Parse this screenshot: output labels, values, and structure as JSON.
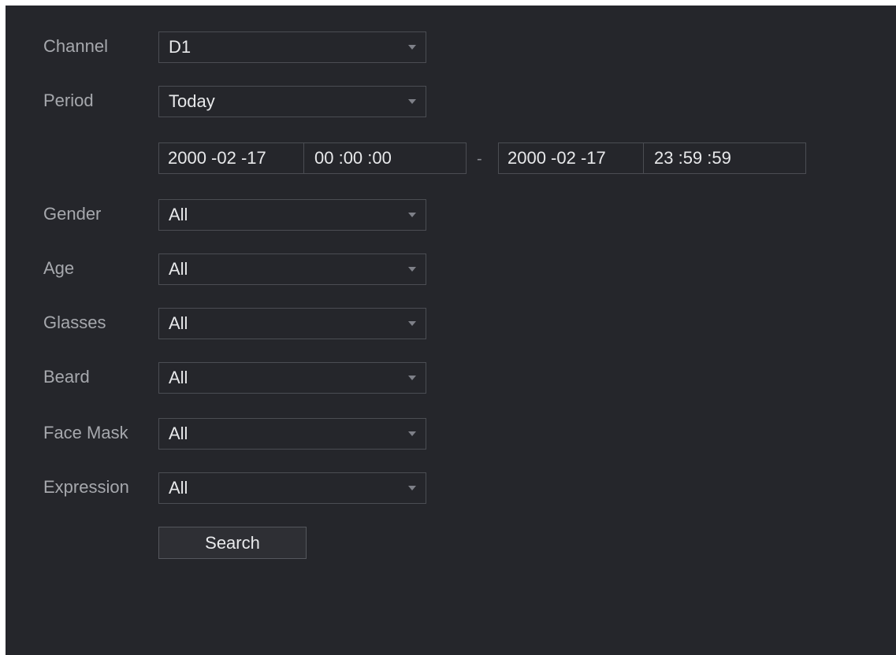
{
  "filters": {
    "channel": {
      "label": "Channel",
      "value": "D1"
    },
    "period": {
      "label": "Period",
      "value": "Today"
    },
    "gender": {
      "label": "Gender",
      "value": "All"
    },
    "age": {
      "label": "Age",
      "value": "All"
    },
    "glasses": {
      "label": "Glasses",
      "value": "All"
    },
    "beard": {
      "label": "Beard",
      "value": "All"
    },
    "face_mask": {
      "label": "Face Mask",
      "value": "All"
    },
    "expression": {
      "label": "Expression",
      "value": "All"
    }
  },
  "time_range": {
    "start_date": "2000 -02 -17",
    "start_time": "00 :00 :00",
    "separator": "-",
    "end_date": "2000 -02 -17",
    "end_time": "23 :59 :59"
  },
  "actions": {
    "search_label": "Search"
  },
  "colors": {
    "panel_background": "#25262b",
    "label_text": "#a6a8ad",
    "value_text": "#e8e9eb",
    "field_border": "#4b4d53"
  },
  "icons": {
    "dropdown": "caret-down-icon"
  }
}
